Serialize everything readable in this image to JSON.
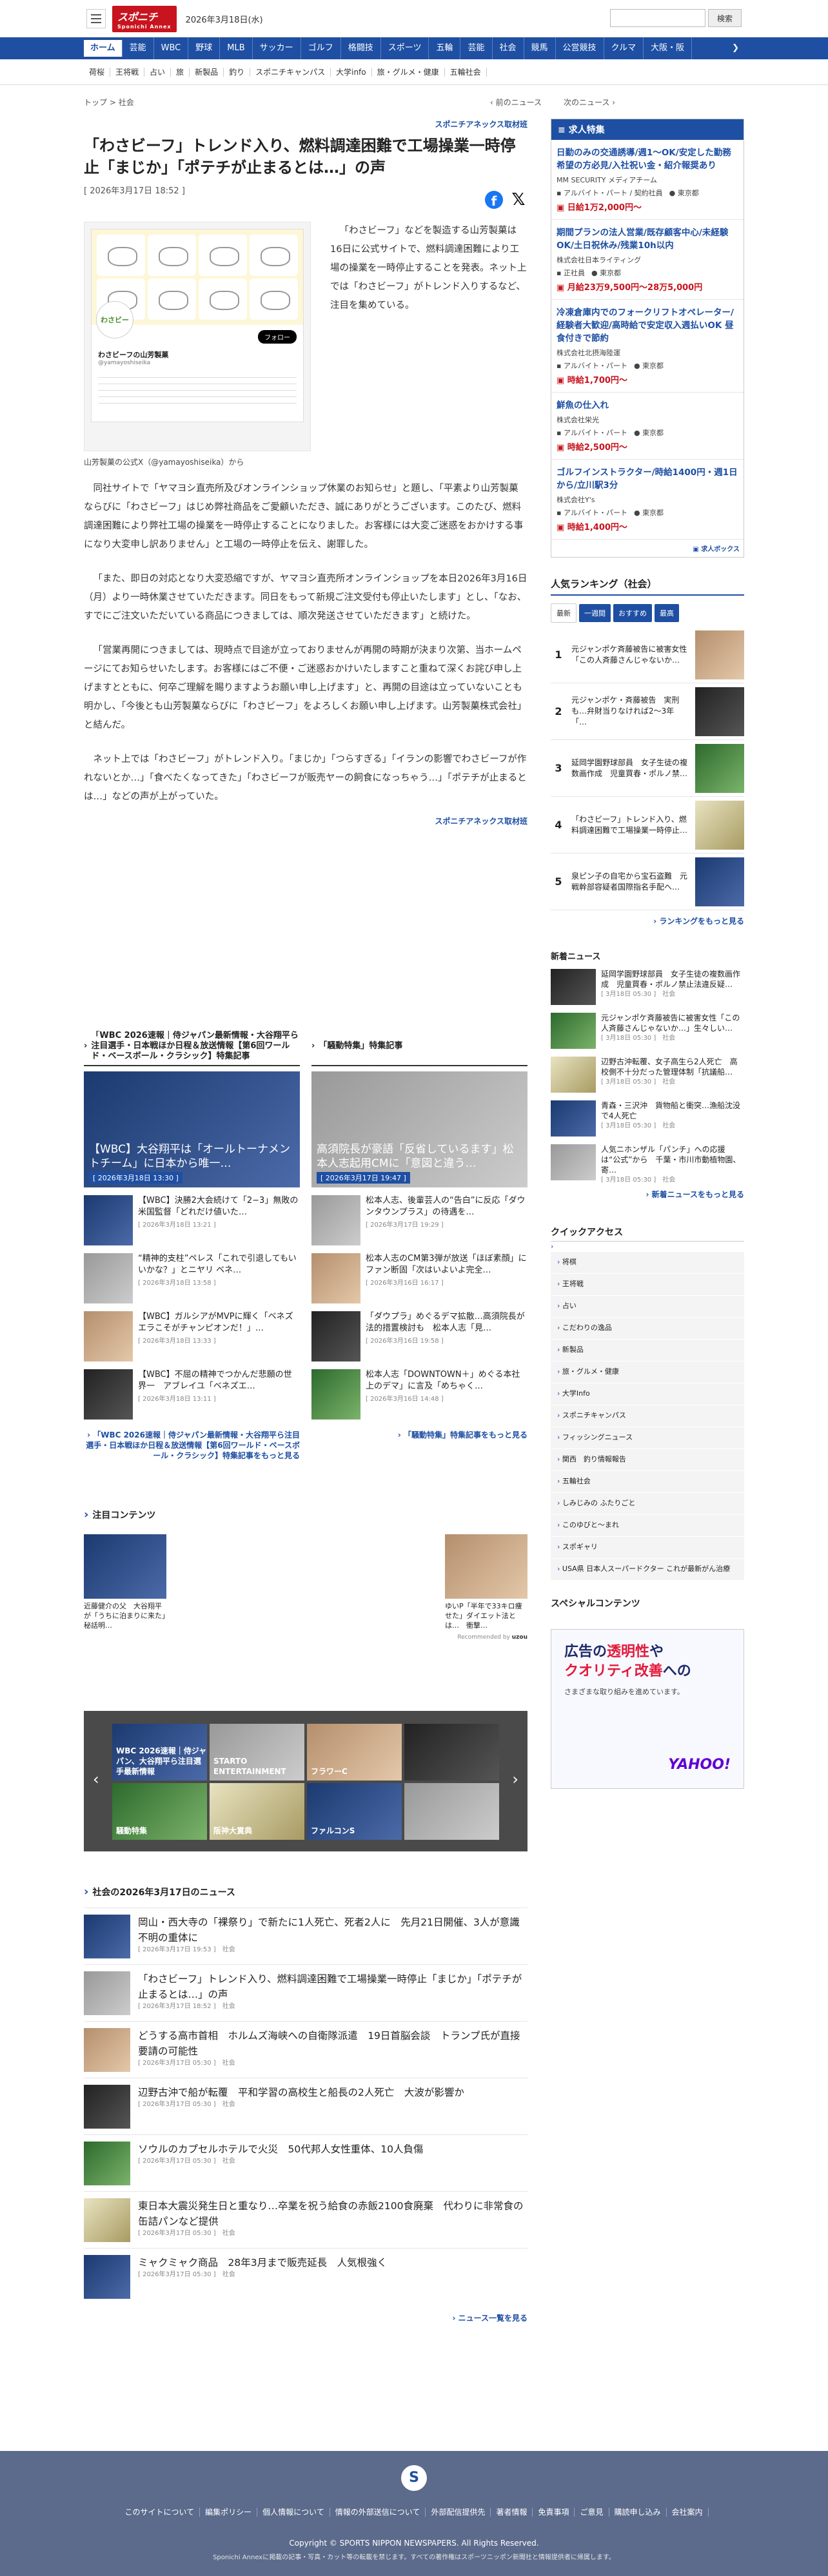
{
  "header": {
    "logo": "スポニチ",
    "logo_sub": "Sponichi Annex",
    "date": "2026年3月18日(水)",
    "search_button": "検索"
  },
  "gnav": [
    "ホーム",
    "芸能",
    "WBC",
    "野球",
    "MLB",
    "サッカー",
    "ゴルフ",
    "格闘技",
    "スポーツ",
    "五輪",
    "芸能",
    "社会",
    "競馬",
    "公営競技",
    "クルマ",
    "大阪・阪"
  ],
  "subnav": [
    "荷桜",
    "王将戦",
    "占い",
    "旅",
    "新製品",
    "釣り",
    "スポニチキャンパス",
    "大学info",
    "旅・グルメ・健康",
    "五輪社会"
  ],
  "breadcrumb": {
    "home": "トップ",
    "sep": ">",
    "section": "社会",
    "prev": "前のニュース",
    "next": "次のニュース"
  },
  "article": {
    "kicker": "スポニチアネックス取材班",
    "title": "「わさビーフ」トレンド入り、燃料調達困難で工場操業一時停止「まじか」「ポテチが止まるとは…」の声",
    "datetime": "[ 2026年3月17日 18:52 ]",
    "caption": "山芳製菓の公式X（@yamayoshiseika）から",
    "tweet": {
      "name": "わさビーフの山芳製菓",
      "handle": "@yamayoshiseika",
      "follow": "フォロー",
      "avatar": "わさビー"
    },
    "p1": "「わさビーフ」などを製造する山芳製菓は16日に公式サイトで、燃料調達困難により工場の操業を一時停止することを発表。ネット上では「わさビーフ」がトレンド入りするなど、注目を集めている。",
    "p2": "同社サイトで「ヤマヨシ直売所及びオンラインショップ休業のお知らせ」と題し、「平素より山芳製菓ならびに「わさビーフ」はじめ弊社商品をご愛顧いただき、誠にありがとうございます。このたび、燃料調達困難により弊社工場の操業を一時停止することになりました。お客様には大変ご迷惑をおかけする事になり大変申し訳ありません」と工場の一時停止を伝え、謝罪した。",
    "p3": "「また、即日の対応となり大変恐縮ですが、ヤマヨシ直売所オンラインショップを本日2026年3月16日（月）より一時休業させていただきます。同日をもって新規ご注文受付も停止いたします」とし、「なお、すでにご注文いただいている商品につきましては、順次発送させていただきます」と続けた。",
    "p4": "「営業再開につきましては、現時点で目途が立っておりませんが再開の時期が決まり次第、当ホームページにてお知らせいたします。お客様にはご不便・ご迷惑おかけいたしますこと重ねて深くお詫び申し上げますとともに、何卒ご理解を賜りますようお願い申し上げます」と、再開の目途は立っていないことも明かし、「今後とも山芳製菓ならびに「わさビーフ」をよろしくお願い申し上げます。山芳製菓株式会社」と結んだ。",
    "p5": "ネット上では「わさビーフ」がトレンド入り。「まじか」「つらすぎる」「イランの影響でわさビーフが作れないとか…」「食べたくなってきた」「わさビーフが販売ヤーの飼食になっちゃう…」「ポテチが止まるとは…」などの声が上がっていた。",
    "source": "スポニチアネックス取材班"
  },
  "feature_left": {
    "heading": "「WBC 2026速報｜侍ジャパン最新情報・大谷翔平ら注目選手・日本戦ほか日程＆放送情報【第6回ワールド・ベースボール・クラシック】特集記事",
    "hero_title": "【WBC】大谷翔平は「オールトーナメントチーム」に日本から唯一…",
    "hero_date": "[ 2026年3月18日 13:30 ]",
    "items": [
      {
        "title": "【WBC】決勝2大会続けて「2−3」無敗の米国監督「どれだけ値いた…",
        "date": "[ 2026年3月18日 13:21 ]"
      },
      {
        "title": "“精神的支柱”ペレス「これで引退してもいいかな？」とニヤリ ベネ…",
        "date": "[ 2026年3月18日 13:58 ]"
      },
      {
        "title": "【WBC】ガルシアがMVPに輝く「ベネズエラこそがチャンピオンだ！」…",
        "date": "[ 2026年3月18日 13:33 ]"
      },
      {
        "title": "【WBC】不屈の精神でつかんだ悲願の世界一　アブレイユ「ベネズエ…",
        "date": "[ 2026年3月18日 13:11 ]"
      }
    ],
    "more": "「WBC 2026速報｜侍ジャパン最新情報・大谷翔平ら注目選手・日本戦ほか日程＆放送情報【第6回ワールド・ベースボール・クラシック】特集記事をもっと見る"
  },
  "feature_right": {
    "heading": "「騒動特集」特集記事",
    "hero_title": "高須院長が豪語「反省しているます」松本人志起用CMに「意図と違う…",
    "hero_date": "[ 2026年3月17日 19:47 ]",
    "items": [
      {
        "title": "松本人志、後輩芸人の“告白”に反応「ダウンタウンプラス」の待遇を…",
        "date": "[ 2026年3月17日 19:29 ]"
      },
      {
        "title": "松本人志のCM第3弾が放送「ほぼ素顔」にファン断固「次はいよいよ完全…",
        "date": "[ 2026年3月16日 16:17 ]"
      },
      {
        "title": "「ダウプラ」めぐるデマ拡散…高須院長が法的措置検討も　松本人志「見…",
        "date": "[ 2026年3月16日 19:58 ]"
      },
      {
        "title": "松本人志「DOWNTOWN＋」めぐる本社上のデマ」に言及「めちゃく…",
        "date": "[ 2026年3月16日 14:48 ]"
      }
    ],
    "more": "「騒動特集」特集記事をもっと見る"
  },
  "attention": {
    "heading": "注目コンテンツ",
    "left": {
      "title": "近藤健介の父　大谷翔平が「うちに泊まりに来た」秘話明…"
    },
    "right": {
      "title": "ゆいP「半年で33キロ痩せた」ダイエット法とは…　衝撃…"
    },
    "credit": "Recommended by"
  },
  "carousel": [
    "WBC 2026速報｜侍ジャパン、大谷翔平ら注目選手最新情報",
    "STARTO ENTERTAINMENT",
    "フラワーC",
    "",
    "騒動特集",
    "阪神大賞典",
    "ファルコンS",
    ""
  ],
  "daylist": {
    "heading": "社会の2026年3月17日のニュース",
    "items": [
      {
        "title": "岡山・西大寺の「裸祭り」で新たに1人死亡、死者2人に　先月21日開催、3人が意識不明の重体に",
        "date": "[ 2026年3月17日 19:53 ]",
        "cat": "社会"
      },
      {
        "title": "「わさビーフ」トレンド入り、燃料調達困難で工場操業一時停止「まじか」「ポテチが止まるとは…」の声",
        "date": "[ 2026年3月17日 18:52 ]",
        "cat": "社会"
      },
      {
        "title": "どうする高市首相　ホルムズ海峡への自衛隊派遣　19日首脳会談　トランプ氏が直接要請の可能性",
        "date": "[ 2026年3月17日 05:30 ]",
        "cat": "社会"
      },
      {
        "title": "辺野古沖で船が転覆　平和学習の高校生と船長の2人死亡　大波が影響か",
        "date": "[ 2026年3月17日 05:30 ]",
        "cat": "社会"
      },
      {
        "title": "ソウルのカプセルホテルで火災　50代邦人女性重体、10人負傷",
        "date": "[ 2026年3月17日 05:30 ]",
        "cat": "社会"
      },
      {
        "title": "東日本大震災発生日と重なり…卒業を祝う給食の赤飯2100食廃棄　代わりに非常食の缶詰パンなど提供",
        "date": "[ 2026年3月17日 05:30 ]",
        "cat": "社会"
      },
      {
        "title": "ミャクミャク商品　28年3月まで販売延長　人気根強く",
        "date": "[ 2026年3月17日 05:30 ]",
        "cat": "社会"
      }
    ],
    "more": "ニュース一覧を見る"
  },
  "jobs": {
    "heading": "求人特集",
    "items": [
      {
        "title": "日勤のみの交通誘導/週1〜OK/安定した勤務希望の方必見/入社祝い金・紹介報奨あり",
        "company": "MM SECURITY メディアチーム",
        "type": "アルバイト・パート / 契約社員",
        "place": "東京都",
        "pay": "日給1万2,000円〜"
      },
      {
        "title": "期間プランの法人営業/既存顧客中心/未経験OK/土日祝休み/残業10h以内",
        "company": "株式会社日本ライティング",
        "type": "正社員",
        "place": "東京都",
        "pay": "月給23万9,500円〜28万5,000円"
      },
      {
        "title": "冷凍倉庫内でのフォークリフトオペレーター/経験者大歓迎/高時給で安定収入週払いOK 昼食付きで節約",
        "company": "株式会社北摂海陸運",
        "type": "アルバイト・パート",
        "place": "東京都",
        "pay": "時給1,700円〜"
      },
      {
        "title": "鮮魚の仕入れ",
        "company": "株式会社栄光",
        "type": "アルバイト・パート",
        "place": "東京都",
        "pay": "時給2,500円〜"
      },
      {
        "title": "ゴルフインストラクター/時給1400円・週1日から/立川駅3分",
        "company": "株式会社Y's",
        "type": "アルバイト・パート",
        "place": "東京都",
        "pay": "時給1,400円〜"
      }
    ],
    "footer": "求人ボックス"
  },
  "ranking": {
    "heading": "人気ランキング（社会）",
    "tabs": [
      "最新",
      "一週間",
      "おすすめ",
      "最高"
    ],
    "items": [
      {
        "n": "1",
        "title": "元ジャンポケ斉藤被告に被害女性「この人斉藤さんじゃないか…"
      },
      {
        "n": "2",
        "title": "元ジャンポケ・斉藤被告　実刑も…弁財当りなければ2〜3年　「…"
      },
      {
        "n": "3",
        "title": "延岡学園野球部員　女子生徒の複数画作成　児童買春・ポルノ禁…"
      },
      {
        "n": "4",
        "title": "「わさビーフ」トレンド入り、燃料調達困難で工場操業一時停止…"
      },
      {
        "n": "5",
        "title": "泉ピン子の自宅から宝石盗難　元戦幹部容疑者国際指名手配へ…"
      }
    ],
    "more": "ランキングをもっと見る"
  },
  "latest": {
    "heading": "新着ニュース",
    "items": [
      {
        "title": "延岡学園野球部員　女子生徒の複数画作成　児童買春・ポルノ禁止法違反疑…",
        "date": "[ 3月18日 05:30 ]",
        "cat": "社会"
      },
      {
        "title": "元ジャンポケ斉藤被告に被害女性「この人斉藤さんじゃないか…」生々しい…",
        "date": "[ 3月18日 05:30 ]",
        "cat": "社会"
      },
      {
        "title": "辺野古沖転覆、女子高生ら2人死亡　高校側不十分だった管理体制「抗議船…",
        "date": "[ 3月18日 05:30 ]",
        "cat": "社会"
      },
      {
        "title": "青森・三沢沖　貨物船と衝突…漁船沈没で4人死亡",
        "date": "[ 3月18日 05:30 ]",
        "cat": "社会"
      },
      {
        "title": "人気ニホンザル「パンチ」への応援は“公式”から　千葉・市川市動植物園、寄…",
        "date": "[ 3月18日 05:30 ]",
        "cat": "社会"
      }
    ],
    "more": "新着ニュースをもっと見る"
  },
  "quick": {
    "heading": "クイックアクセス",
    "items": [
      "将棋",
      "王将戦",
      "占い",
      "こだわりの逸品",
      "新製品",
      "旅・グルメ・健康",
      "大学Info",
      "スポニチキャンパス",
      "フィッシングニュース",
      "関西　釣り情報報告",
      "五輪社会",
      "しみじみの ふたりごと",
      "このゆびと〜まれ",
      "スポギャリ",
      "USA県 日本人スーパードクター これが最新がん治療"
    ]
  },
  "special": {
    "heading": "スペシャルコンテンツ",
    "ad_l1a": "広告の",
    "ad_l1b": "透明性",
    "ad_l1c": "や",
    "ad_l2a": "クオリティ",
    "ad_l2b": "改善",
    "ad_l2c": "への",
    "ad_sub": "さまざまな取り組みを進めています。",
    "ad_brand": "YAHOO!"
  },
  "footer": {
    "links": [
      "このサイトについて",
      "編集ポリシー",
      "個人情報について",
      "情報の外部送信について",
      "外部配信提供先",
      "著者情報",
      "免責事項",
      "ご意見",
      "購読申し込み",
      "会社案内"
    ],
    "copyright": "Copyright © SPORTS NIPPON NEWSPAPERS. All Rights Reserved.",
    "notice": "Sponichi Annexに掲載の記事・写真・カット等の転載を禁じます。すべての著作権はスポーツニッポン新聞社と情報提供者に帰属します。",
    "logo": "S"
  }
}
